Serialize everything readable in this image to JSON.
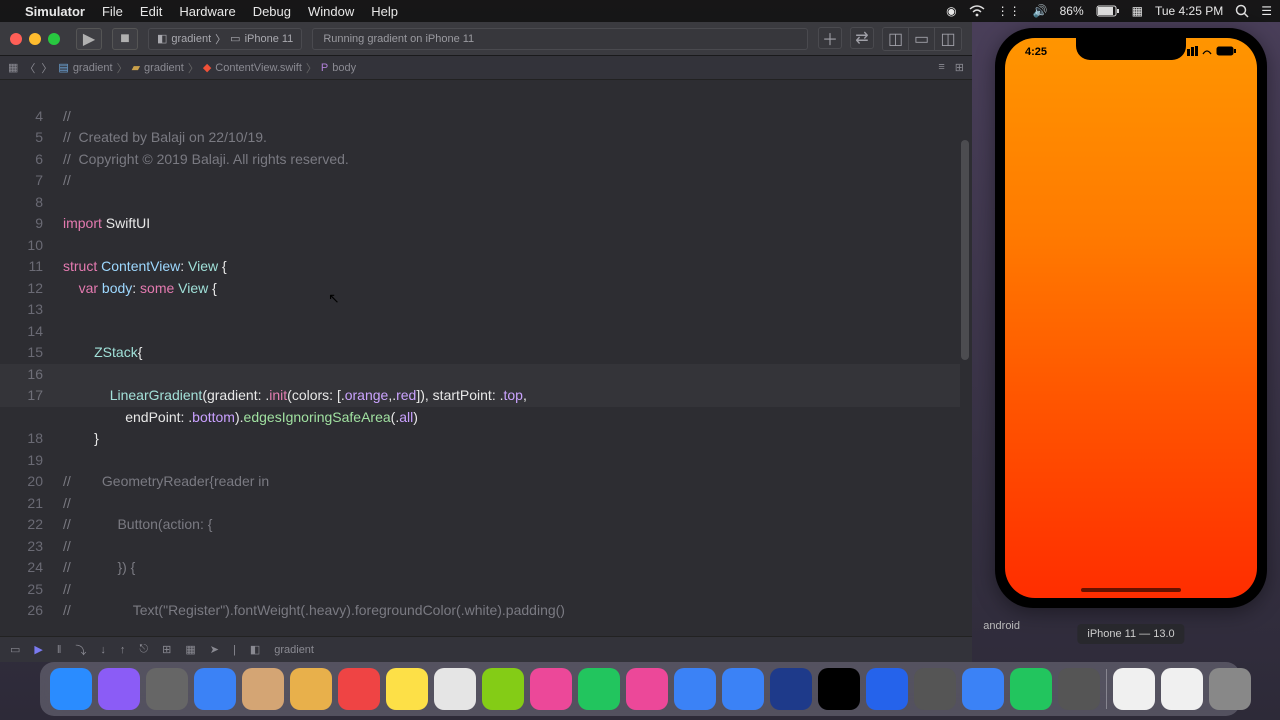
{
  "menubar": {
    "app": "Simulator",
    "items": [
      "File",
      "Edit",
      "Hardware",
      "Debug",
      "Window",
      "Help"
    ],
    "battery": "86%",
    "charging_icon": "⚡",
    "date_icon": "📅",
    "time": "Tue 4:25 PM"
  },
  "xcode": {
    "scheme_app": "gradient",
    "scheme_device": "iPhone 11",
    "status": "Running gradient on iPhone 11",
    "breadcrumb": [
      "gradient",
      "gradient",
      "ContentView.swift",
      "body"
    ],
    "bottom_target": "gradient"
  },
  "code": {
    "lines": [
      {
        "n": "",
        "segs": []
      },
      {
        "n": "4",
        "segs": [
          [
            "c-comment",
            "//"
          ]
        ]
      },
      {
        "n": "5",
        "segs": [
          [
            "c-comment",
            "//  Created by Balaji on 22/10/19."
          ]
        ]
      },
      {
        "n": "6",
        "segs": [
          [
            "c-comment",
            "//  Copyright © 2019 Balaji. All rights reserved."
          ]
        ]
      },
      {
        "n": "7",
        "segs": [
          [
            "c-comment",
            "//"
          ]
        ]
      },
      {
        "n": "8",
        "segs": []
      },
      {
        "n": "9",
        "segs": [
          [
            "c-keyword",
            "import"
          ],
          [
            "c-plain",
            " "
          ],
          [
            "c-plain",
            "SwiftUI"
          ]
        ]
      },
      {
        "n": "10",
        "segs": []
      },
      {
        "n": "11",
        "segs": [
          [
            "c-keyword",
            "struct"
          ],
          [
            "c-plain",
            " "
          ],
          [
            "c-name",
            "ContentView"
          ],
          [
            "c-plain",
            ": "
          ],
          [
            "c-type",
            "View"
          ],
          [
            "c-plain",
            " {"
          ]
        ]
      },
      {
        "n": "12",
        "segs": [
          [
            "c-plain",
            "    "
          ],
          [
            "c-keyword",
            "var"
          ],
          [
            "c-plain",
            " "
          ],
          [
            "c-name",
            "body"
          ],
          [
            "c-plain",
            ": "
          ],
          [
            "c-some",
            "some"
          ],
          [
            "c-plain",
            " "
          ],
          [
            "c-type",
            "View"
          ],
          [
            "c-plain",
            " {"
          ]
        ]
      },
      {
        "n": "13",
        "segs": []
      },
      {
        "n": "14",
        "segs": []
      },
      {
        "n": "15",
        "segs": [
          [
            "c-plain",
            "        "
          ],
          [
            "c-type",
            "ZStack"
          ],
          [
            "c-plain",
            "{"
          ]
        ]
      },
      {
        "n": "16",
        "segs": []
      },
      {
        "n": "17",
        "segs": [
          [
            "c-plain",
            "            "
          ],
          [
            "c-type",
            "LinearGradient"
          ],
          [
            "c-plain",
            "("
          ],
          [
            "c-plain",
            "gradient: ."
          ],
          [
            "c-keyword",
            "init"
          ],
          [
            "c-plain",
            "(colors: [."
          ],
          [
            "c-enum",
            "orange"
          ],
          [
            "c-plain",
            ",."
          ],
          [
            "c-enum",
            "red"
          ],
          [
            "c-plain",
            "]), startPoint: ."
          ],
          [
            "c-enum",
            "top"
          ],
          [
            "c-plain",
            ","
          ]
        ]
      },
      {
        "n": "",
        "segs": [
          [
            "c-plain",
            "                endPoint: ."
          ],
          [
            "c-enum",
            "bottom"
          ],
          [
            "c-plain",
            ")."
          ],
          [
            "c-func",
            "edgesIgnoringSafeArea"
          ],
          [
            "c-plain",
            "(."
          ],
          [
            "c-enum",
            "all"
          ],
          [
            "c-plain",
            ")"
          ]
        ]
      },
      {
        "n": "18",
        "segs": [
          [
            "c-plain",
            "        }"
          ]
        ]
      },
      {
        "n": "19",
        "segs": []
      },
      {
        "n": "20",
        "segs": [
          [
            "c-comment",
            "//        GeometryReader{reader in"
          ]
        ]
      },
      {
        "n": "21",
        "segs": [
          [
            "c-comment",
            "//"
          ]
        ]
      },
      {
        "n": "22",
        "segs": [
          [
            "c-comment",
            "//            Button(action: {"
          ]
        ]
      },
      {
        "n": "23",
        "segs": [
          [
            "c-comment",
            "//"
          ]
        ]
      },
      {
        "n": "24",
        "segs": [
          [
            "c-comment",
            "//            }) {"
          ]
        ]
      },
      {
        "n": "25",
        "segs": [
          [
            "c-comment",
            "//"
          ]
        ]
      },
      {
        "n": "26",
        "segs": [
          [
            "c-comment",
            "//                Text(\"Register\").fontWeight(.heavy).foregroundColor(.white).padding()"
          ]
        ]
      }
    ]
  },
  "simulator": {
    "time": "4:25",
    "label": "iPhone 11 — 13.0",
    "side_label": "android"
  },
  "dock_colors": [
    "#2a8cff",
    "#8b5cf6",
    "#666",
    "#3b82f6",
    "#d4a574",
    "#e8b04b",
    "#ef4444",
    "#fde047",
    "#e5e5e5",
    "#84cc16",
    "#ec4899",
    "#22c55e",
    "#ec4899",
    "#3b82f6",
    "#3b82f6",
    "#1e3a8a",
    "#000",
    "#2563eb",
    "#555",
    "#3b82f6",
    "#22c55e",
    "#555"
  ],
  "dock_colors2": [
    "#f0f0f0",
    "#f0f0f0",
    "#888"
  ]
}
